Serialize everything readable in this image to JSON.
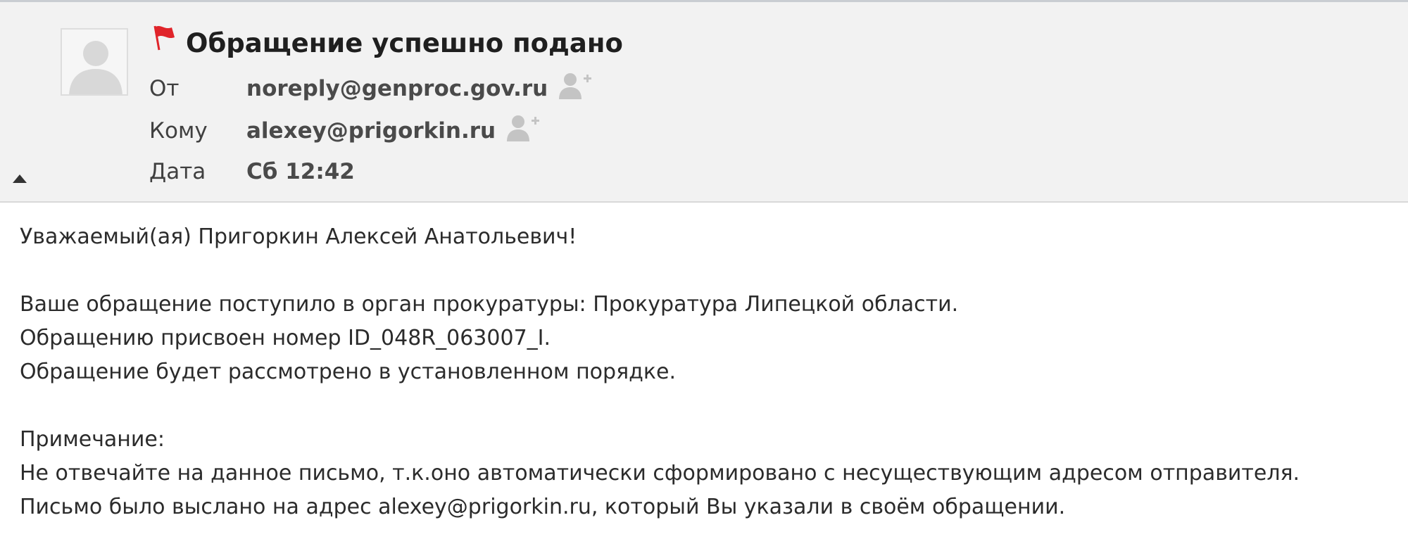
{
  "email": {
    "subject": "Обращение успешно подано",
    "from_label": "От",
    "from_value": "noreply@genproc.gov.ru",
    "to_label": "Кому",
    "to_value": "alexey@prigorkin.ru",
    "date_label": "Дата",
    "date_value": "Сб 12:42"
  },
  "icons": {
    "flag": "red-flag-icon",
    "avatar": "user-silhouette-icon",
    "add_contact": "add-contact-icon",
    "collapse": "triangle-up-icon"
  },
  "colors": {
    "flag": "#e0242a",
    "header_bg": "#f2f2f2",
    "icon_gray": "#c4c4c4"
  },
  "body": {
    "greeting": "Уважаемый(ая) Пригоркин Алексей Анатольевич!",
    "line1": "Ваше обращение поступило в орган прокуратуры: Прокуратура Липецкой области.",
    "line2": "Обращению присвоен номер ID_048R_063007_I.",
    "line3": "Обращение будет рассмотрено в установленном порядке.",
    "note_label": "Примечание:",
    "note1": "Не отвечайте на данное письмо, т.к.оно автоматически сформировано с несуществующим адресом отправителя.",
    "note2": "Письмо было выслано на адрес alexey@prigorkin.ru, который Вы указали в своём обращении."
  }
}
